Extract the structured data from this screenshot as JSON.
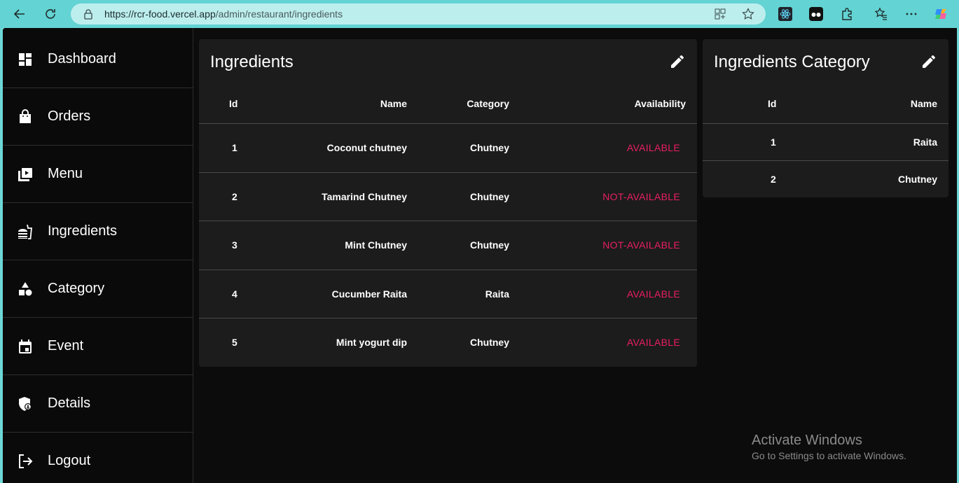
{
  "browser": {
    "url_host": "https://rcr-food.vercel.app",
    "url_path": "/admin/restaurant/ingredients"
  },
  "sidebar": {
    "items": [
      {
        "label": "Dashboard",
        "icon": "dashboard-icon"
      },
      {
        "label": "Orders",
        "icon": "shopping-bag-icon"
      },
      {
        "label": "Menu",
        "icon": "menu-book-icon"
      },
      {
        "label": "Ingredients",
        "icon": "fastfood-icon"
      },
      {
        "label": "Category",
        "icon": "category-icon"
      },
      {
        "label": "Event",
        "icon": "event-icon"
      },
      {
        "label": "Details",
        "icon": "admin-panel-icon"
      },
      {
        "label": "Logout",
        "icon": "logout-icon"
      }
    ]
  },
  "ingredients": {
    "title": "Ingredients",
    "columns": {
      "id": "Id",
      "name": "Name",
      "category": "Category",
      "availability": "Availability"
    },
    "rows": [
      {
        "id": "1",
        "name": "Coconut chutney",
        "category": "Chutney",
        "availability": "AVAILABLE"
      },
      {
        "id": "2",
        "name": "Tamarind Chutney",
        "category": "Chutney",
        "availability": "NOT-AVAILABLE"
      },
      {
        "id": "3",
        "name": "Mint Chutney",
        "category": "Chutney",
        "availability": "NOT-AVAILABLE"
      },
      {
        "id": "4",
        "name": "Cucumber Raita",
        "category": "Raita",
        "availability": "AVAILABLE"
      },
      {
        "id": "5",
        "name": "Mint yogurt dip",
        "category": "Chutney",
        "availability": "AVAILABLE"
      }
    ]
  },
  "ingredient_category": {
    "title": "Ingredients Category",
    "columns": {
      "id": "Id",
      "name": "Name"
    },
    "rows": [
      {
        "id": "1",
        "name": "Raita"
      },
      {
        "id": "2",
        "name": "Chutney"
      }
    ]
  },
  "watermark": {
    "line1": "Activate Windows",
    "line2": "Go to Settings to activate Windows."
  },
  "colors": {
    "accent": "#e91e63",
    "chrome": "#63d3d3",
    "card": "#1c1c1c"
  }
}
